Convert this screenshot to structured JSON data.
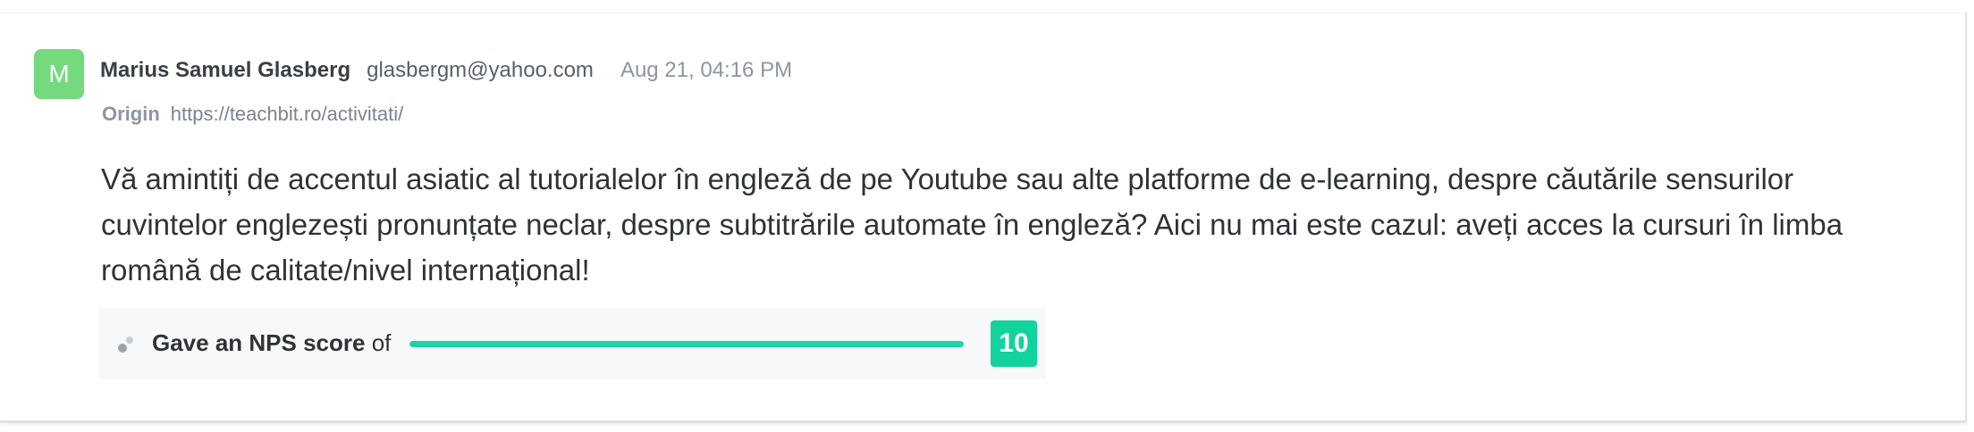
{
  "response": {
    "avatar_initial": "M",
    "avatar_color": "#75d97e",
    "author_name": "Marius Samuel Glasberg",
    "author_email": "glasbergm@yahoo.com",
    "timestamp": "Aug 21, 04:16 PM",
    "origin_label": "Origin",
    "origin_url": "https://teachbit.ro/activitati/",
    "message": "Vă amintiți de accentul asiatic al tutorialelor în engleză de pe Youtube sau alte platforme de e-learning, despre căutările sensurilor cuvintelor englezești pronunțate neclar, despre subtitrările automate în engleză? Aici nu mai este cazul: aveți acces la cursuri în limba română de calitate/nivel internațional!"
  },
  "nps": {
    "icon": "nps-dots-icon",
    "label_strong": "Gave an NPS score",
    "label_suffix": " of",
    "score": "10",
    "score_fraction": 1.0,
    "accent_color": "#12d39e"
  }
}
